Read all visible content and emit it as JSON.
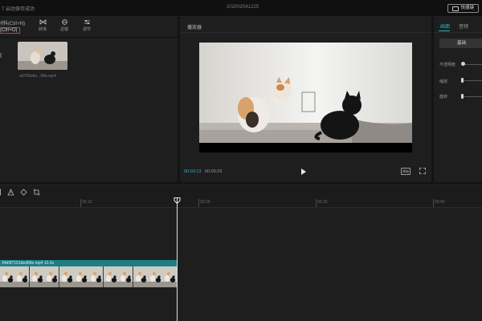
{
  "app": {
    "top_left_text": "7  启动保存成功",
    "top_center_text": "202002041225",
    "shortcut_button_label": "快捷键"
  },
  "media": {
    "menu_items": [
      "材料(Ctrl+N)",
      "(Ctrl+O)"
    ],
    "tools": [
      {
        "label": "转场",
        "icon": "transition-icon"
      },
      {
        "label": "滤镜",
        "icon": "filter-icon"
      },
      {
        "label": "调节",
        "icon": "adjust-icon"
      }
    ],
    "file_name": "a3706a6e...68e.mp4"
  },
  "player": {
    "title": "播放器",
    "time_current": "00:00:13",
    "time_total": "00:00:29",
    "ratio_label": "原始"
  },
  "properties": {
    "tabs": [
      "画面",
      "音频"
    ],
    "basic_button": "基础",
    "labels": [
      "不透明度",
      "缩放",
      "旋转"
    ]
  },
  "timeline": {
    "ruler_labels": [
      "00:10",
      "00:20",
      "00:30",
      "00:40"
    ],
    "clip_name": "34d9f7151ded68e.mp4",
    "clip_duration": "10.3s"
  },
  "colors": {
    "accent": "#2bb3c0",
    "clip_header": "#1e7e86",
    "highlight_box": "#d53a3a"
  }
}
